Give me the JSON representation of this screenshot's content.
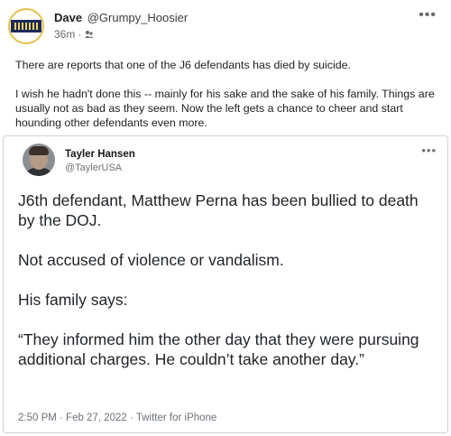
{
  "post": {
    "author_name": "Dave",
    "author_handle": "@Grumpy_Hoosier",
    "time": "36m",
    "visibility_icon": "audience-icon",
    "more_label": "•••",
    "paragraphs": [
      "There are reports that one of the J6 defendants has died by suicide.",
      "I wish he hadn't done this -- mainly for his sake and the sake of his family. Things are usually not as bad as they seem. Now the left gets a chance to cheer and start hounding other defendants even more."
    ]
  },
  "tweet": {
    "author_name": "Tayler Hansen",
    "author_handle": "@TaylerUSA",
    "more_label": "•••",
    "paragraphs": [
      "J6th defendant, Matthew Perna has been bullied to death by the DOJ.",
      "Not accused of violence or vandalism.",
      "His family says:",
      "“They informed him the other day that they were pursuing additional charges. He couldn’t take another day.”"
    ],
    "meta": "2:50 PM · Feb 27, 2022 · Twitter for iPhone"
  }
}
